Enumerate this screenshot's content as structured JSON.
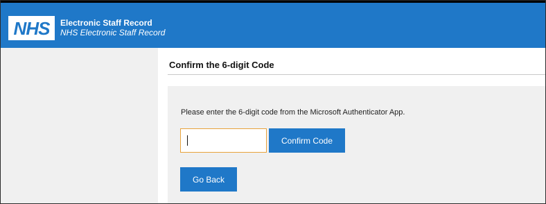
{
  "header": {
    "logo_text": "NHS",
    "title": "Electronic Staff Record",
    "subtitle": "NHS Electronic Staff Record"
  },
  "main": {
    "page_title": "Confirm the 6-digit Code",
    "instruction": "Please enter the 6-digit code from the Microsoft Authenticator App.",
    "code_input": {
      "value": "",
      "placeholder": ""
    },
    "confirm_label": "Confirm Code",
    "back_label": "Go Back"
  },
  "colors": {
    "brand_blue": "#1f78c8",
    "input_focus_border": "#e8a23a",
    "panel_gray": "#f0f0f0"
  }
}
